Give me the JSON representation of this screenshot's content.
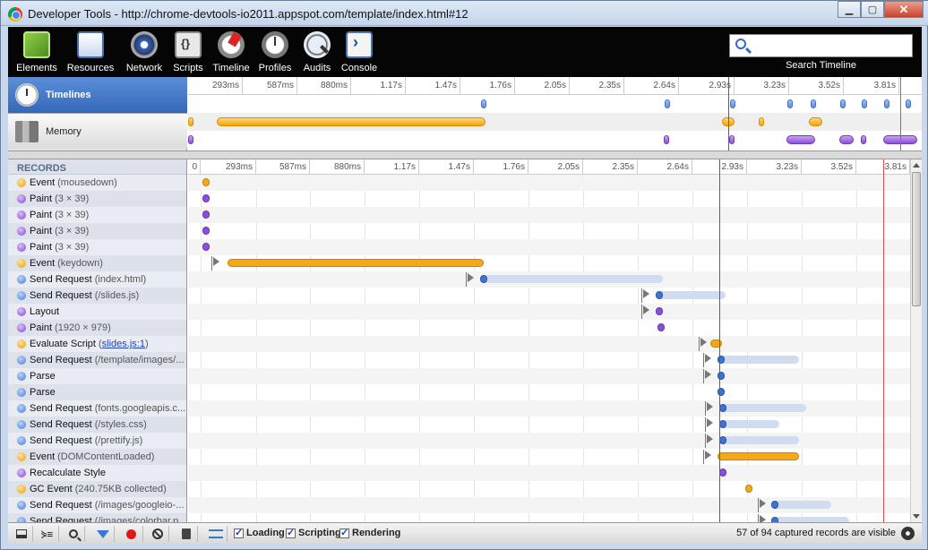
{
  "window": {
    "title": "Developer Tools - http://chrome-devtools-io2011.appspot.com/template/index.html#12"
  },
  "toolbar": {
    "tabs": [
      {
        "label": "Elements",
        "icon": "elements-icon"
      },
      {
        "label": "Resources",
        "icon": "resources-icon"
      },
      {
        "label": "Network",
        "icon": "network-icon"
      },
      {
        "label": "Scripts",
        "icon": "scripts-icon"
      },
      {
        "label": "Timeline",
        "icon": "timeline-icon"
      },
      {
        "label": "Profiles",
        "icon": "profiles-icon"
      },
      {
        "label": "Audits",
        "icon": "audits-icon"
      },
      {
        "label": "Console",
        "icon": "console-icon"
      }
    ],
    "search_label": "Search Timeline",
    "search_value": ""
  },
  "overview": {
    "items": [
      {
        "label": "Timelines",
        "selected": true
      },
      {
        "label": "Memory",
        "selected": false
      }
    ],
    "ticks": [
      "293ms",
      "587ms",
      "880ms",
      "1.17s",
      "1.47s",
      "1.76s",
      "2.05s",
      "2.35s",
      "2.64s",
      "2.93s",
      "3.23s",
      "3.52s",
      "3.81s"
    ]
  },
  "records": {
    "header": "RECORDS",
    "ticks": [
      "0",
      "293ms",
      "587ms",
      "880ms",
      "1.17s",
      "1.47s",
      "1.76s",
      "2.05s",
      "2.35s",
      "2.64s",
      "2.93s",
      "3.23s",
      "3.52s",
      "3.81s"
    ],
    "items": [
      {
        "title": "Event",
        "detail": "(mousedown)",
        "category": "scripting"
      },
      {
        "title": "Paint",
        "detail": "(3 × 39)",
        "category": "rendering"
      },
      {
        "title": "Paint",
        "detail": "(3 × 39)",
        "category": "rendering"
      },
      {
        "title": "Paint",
        "detail": "(3 × 39)",
        "category": "rendering"
      },
      {
        "title": "Paint",
        "detail": "(3 × 39)",
        "category": "rendering"
      },
      {
        "title": "Event",
        "detail": "(keydown)",
        "category": "scripting"
      },
      {
        "title": "Send Request",
        "detail": "(index.html)",
        "category": "loading"
      },
      {
        "title": "Send Request",
        "detail": "(/slides.js)",
        "category": "loading"
      },
      {
        "title": "Layout",
        "detail": "",
        "category": "rendering"
      },
      {
        "title": "Paint",
        "detail": "(1920 × 979)",
        "category": "rendering"
      },
      {
        "title": "Evaluate Script",
        "detail": "(slides.js:1)",
        "link": "slides.js:1",
        "category": "scripting"
      },
      {
        "title": "Send Request",
        "detail": "(/template/images/...",
        "category": "loading"
      },
      {
        "title": "Parse",
        "detail": "",
        "category": "loading"
      },
      {
        "title": "Parse",
        "detail": "",
        "category": "loading"
      },
      {
        "title": "Send Request",
        "detail": "(fonts.googleapis.c...",
        "category": "loading"
      },
      {
        "title": "Send Request",
        "detail": "(/styles.css)",
        "category": "loading"
      },
      {
        "title": "Send Request",
        "detail": "(/prettify.js)",
        "category": "loading"
      },
      {
        "title": "Event",
        "detail": "(DOMContentLoaded)",
        "category": "scripting"
      },
      {
        "title": "Recalculate Style",
        "detail": "",
        "category": "rendering"
      },
      {
        "title": "GC Event",
        "detail": "(240.75KB collected)",
        "category": "scripting"
      },
      {
        "title": "Send Request",
        "detail": "(/images/googleio-...",
        "category": "loading"
      },
      {
        "title": "Send Request",
        "detail": "(/images/colorbar.p...",
        "category": "loading"
      }
    ]
  },
  "statusbar": {
    "filters": [
      {
        "label": "Loading",
        "checked": true
      },
      {
        "label": "Scripting",
        "checked": true
      },
      {
        "label": "Rendering",
        "checked": true
      }
    ],
    "status": "57 of 94 captured records are visible"
  },
  "colors": {
    "loading": "#5b8ee0",
    "scripting": "#f3a60c",
    "rendering": "#8b4fd8",
    "selected": "#3468b8"
  }
}
